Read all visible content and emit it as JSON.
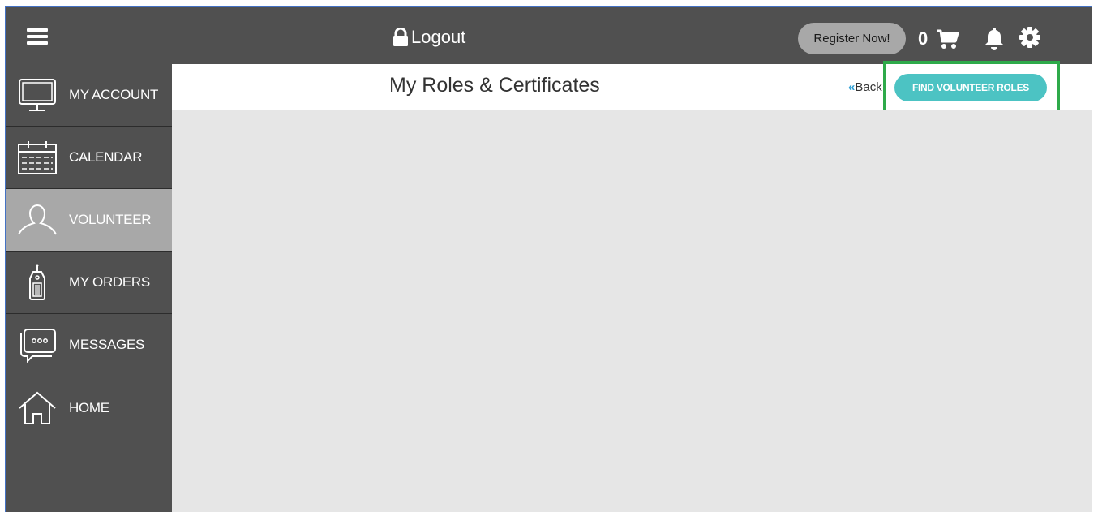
{
  "topbar": {
    "logout_label": "Logout",
    "register_label": "Register Now!",
    "cart_count": "0",
    "icons": [
      "menu-icon",
      "lock-icon",
      "cart-icon",
      "bell-icon",
      "gear-icon"
    ]
  },
  "sidebar": {
    "items": [
      {
        "label": "MY ACCOUNT",
        "icon": "monitor-icon",
        "active": false
      },
      {
        "label": "CALENDAR",
        "icon": "calendar-icon",
        "active": false
      },
      {
        "label": "VOLUNTEER",
        "icon": "person-icon",
        "active": true
      },
      {
        "label": "MY ORDERS",
        "icon": "tag-icon",
        "active": false
      },
      {
        "label": "MESSAGES",
        "icon": "chat-icon",
        "active": false
      },
      {
        "label": "HOME",
        "icon": "home-icon",
        "active": false
      }
    ]
  },
  "header": {
    "title": "My Roles & Certificates",
    "back_chevron": "«",
    "back_label": "Back",
    "find_button_label": "FIND VOLUNTEER ROLES"
  },
  "colors": {
    "topbar": "#505050",
    "sidebar_active": "#a8a8a8",
    "accent_teal": "#4cc3c3",
    "highlight_green": "#2eaa4a",
    "back_chevron": "#2e9fd4"
  }
}
